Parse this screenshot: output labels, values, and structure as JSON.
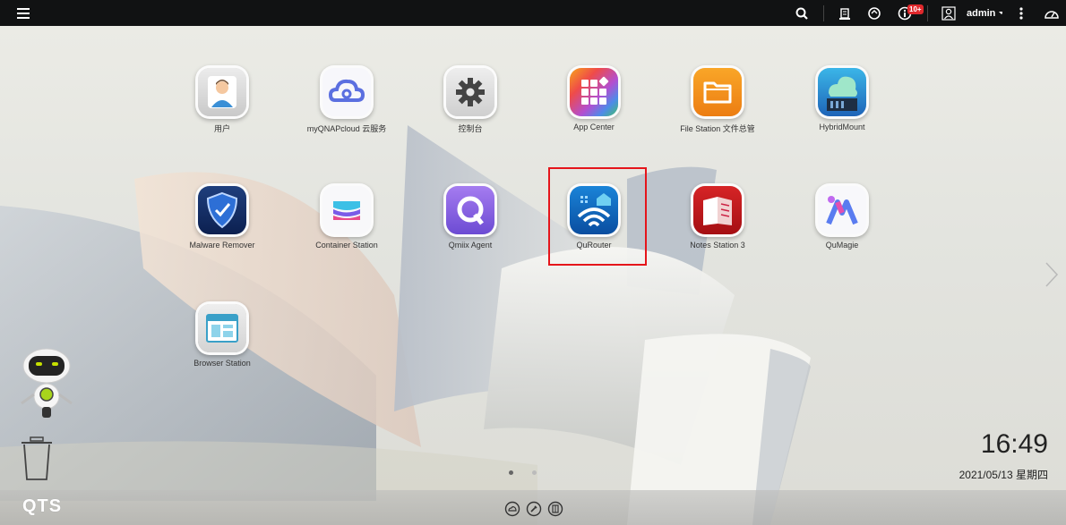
{
  "topbar": {
    "notification_badge": "10+",
    "user_name": "admin"
  },
  "apps": [
    {
      "label": "用户"
    },
    {
      "label": "myQNAPcloud 云服务"
    },
    {
      "label": "控制台"
    },
    {
      "label": "App Center"
    },
    {
      "label": "File Station 文件总管"
    },
    {
      "label": "HybridMount"
    },
    {
      "label": "Malware Remover"
    },
    {
      "label": "Container Station"
    },
    {
      "label": "Qmiix Agent"
    },
    {
      "label": "QuRouter"
    },
    {
      "label": "Notes Station 3"
    },
    {
      "label": "QuMagie"
    },
    {
      "label": "Browser Station"
    }
  ],
  "clock": {
    "time": "16:49",
    "date": "2021/05/13 星期四"
  },
  "bottombar": {
    "logo": "QTS"
  },
  "pager": {
    "current": 1,
    "total": 2
  }
}
